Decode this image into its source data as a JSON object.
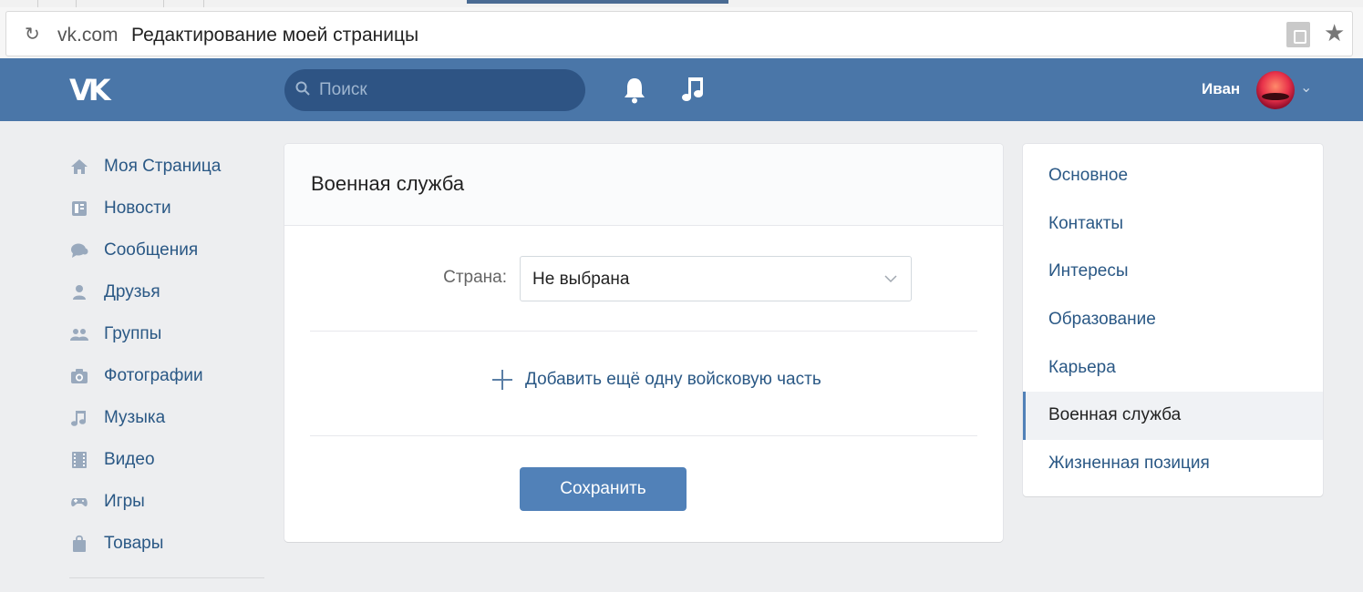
{
  "browser": {
    "url_domain": "vk.com",
    "page_title": "Редактирование моей страницы"
  },
  "header": {
    "logo_text": "VK",
    "search_placeholder": "Поиск",
    "user_name": "Иван",
    "brand_color": "#4a76a8"
  },
  "sidebar": {
    "items": [
      {
        "label": "Моя Страница",
        "icon": "home-icon"
      },
      {
        "label": "Новости",
        "icon": "news-icon"
      },
      {
        "label": "Сообщения",
        "icon": "messages-icon"
      },
      {
        "label": "Друзья",
        "icon": "friends-icon"
      },
      {
        "label": "Группы",
        "icon": "groups-icon"
      },
      {
        "label": "Фотографии",
        "icon": "camera-icon"
      },
      {
        "label": "Музыка",
        "icon": "music-icon"
      },
      {
        "label": "Видео",
        "icon": "video-icon"
      },
      {
        "label": "Игры",
        "icon": "gamepad-icon"
      },
      {
        "label": "Товары",
        "icon": "bag-icon"
      }
    ]
  },
  "main": {
    "title": "Военная служба",
    "country_label": "Страна:",
    "country_value": "Не выбрана",
    "add_link": "Добавить ещё одну войсковую часть",
    "save_label": "Сохранить"
  },
  "menu": {
    "items": [
      {
        "label": "Основное",
        "active": false
      },
      {
        "label": "Контакты",
        "active": false
      },
      {
        "label": "Интересы",
        "active": false
      },
      {
        "label": "Образование",
        "active": false
      },
      {
        "label": "Карьера",
        "active": false
      },
      {
        "label": "Военная служба",
        "active": true
      },
      {
        "label": "Жизненная позиция",
        "active": false
      }
    ]
  }
}
